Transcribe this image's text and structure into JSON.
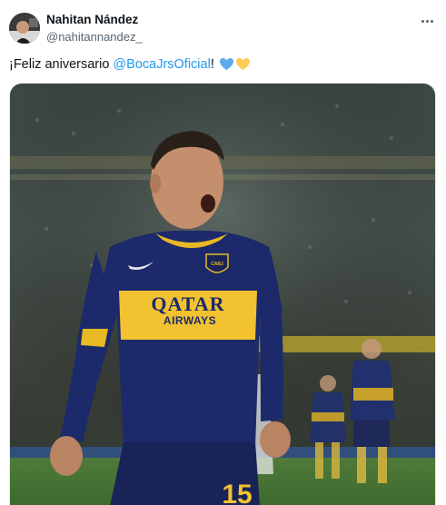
{
  "author": {
    "name": "Nahitan Nández",
    "handle": "@nahitannandez_"
  },
  "tweet": {
    "text_before": "¡Feliz aniversario ",
    "mention": "@BocaJrsOficial",
    "text_after": "! "
  },
  "icons": {
    "more": "more-horizontal-icon",
    "heart_blue": "blue-heart-emoji",
    "heart_yellow": "yellow-heart-emoji"
  },
  "media": {
    "jersey_sponsor_line1": "QATAR",
    "jersey_sponsor_line2": "AIRWAYS",
    "jersey_number": "15",
    "crest_text": "CABJ"
  },
  "colors": {
    "mention": "#1d9bf0",
    "heart_blue": "#5dadec",
    "heart_yellow": "#fdcb58",
    "boca_blue": "#1c2a6b",
    "boca_gold": "#f2c230"
  }
}
